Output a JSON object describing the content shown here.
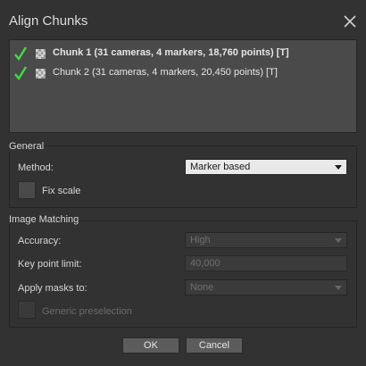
{
  "window": {
    "title": "Align Chunks"
  },
  "chunks": [
    {
      "label": "Chunk 1 (31 cameras, 4 markers, 18,760 points) [T]",
      "checked": true
    },
    {
      "label": "Chunk 2 (31 cameras, 4 markers, 20,450 points) [T]",
      "checked": true
    }
  ],
  "general": {
    "title": "General",
    "method_label": "Method:",
    "method_value": "Marker based",
    "fix_scale_label": "Fix scale"
  },
  "image_matching": {
    "title": "Image Matching",
    "accuracy_label": "Accuracy:",
    "accuracy_value": "High",
    "key_point_limit_label": "Key point limit:",
    "key_point_limit_value": "40,000",
    "apply_masks_label": "Apply masks to:",
    "apply_masks_value": "None",
    "generic_preselection_label": "Generic preselection"
  },
  "buttons": {
    "ok": "OK",
    "cancel": "Cancel"
  },
  "colors": {
    "check": "#3ddc3d",
    "background": "#323232"
  }
}
